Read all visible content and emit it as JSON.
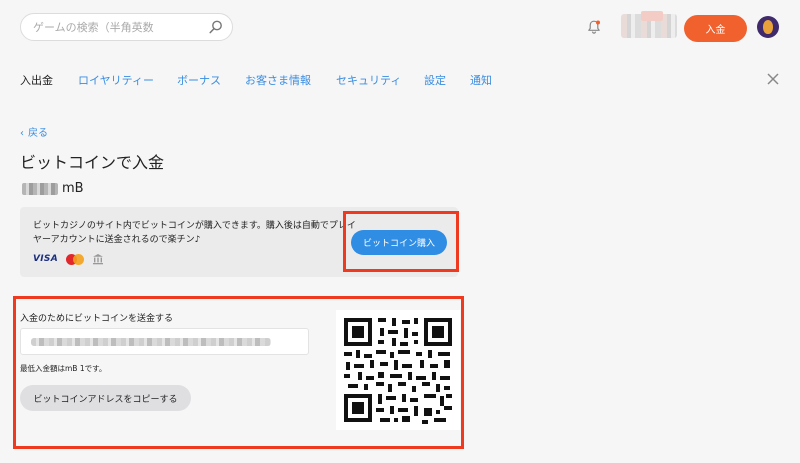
{
  "header": {
    "search_placeholder": "ゲームの検索（半角英数",
    "deposit_button": "入金"
  },
  "tabs": [
    {
      "label": "入出金",
      "active": true
    },
    {
      "label": "ロイヤリティー"
    },
    {
      "label": "ボーナス"
    },
    {
      "label": "お客さま情報"
    },
    {
      "label": "セキュリティ"
    },
    {
      "label": "設定"
    },
    {
      "label": "通知"
    }
  ],
  "back_label": "戻る",
  "page_title": "ビットコインで入金",
  "balance_unit": "mB",
  "buy": {
    "description": "ビットカジノのサイト内でビットコインが購入できます。購入後は自動でプレイヤーアカウントに送金されるので楽チン♪",
    "payment_methods": [
      "VISA",
      "mastercard-icon",
      "bank-icon"
    ],
    "visa_label": "VISA",
    "button": "ビットコイン購入"
  },
  "send": {
    "label": "入金のためにビットコインを送金する",
    "min_note": "最低入金額はmB 1です。",
    "copy_button": "ビットコインアドレスをコピーする"
  },
  "colors": {
    "accent_orange": "#f1612e",
    "link_blue": "#3a8de0",
    "button_blue": "#2f8de4",
    "highlight_red": "#f03a1f"
  }
}
